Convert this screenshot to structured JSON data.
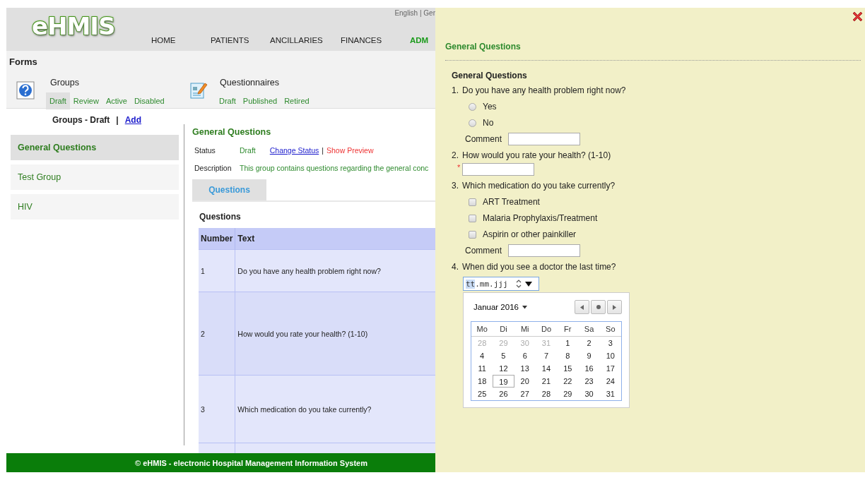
{
  "header": {
    "logo": "eHMIS",
    "languages": "English | Ger",
    "nav": [
      {
        "label": "HOME",
        "selected": false
      },
      {
        "label": "PATIENTS",
        "selected": false
      },
      {
        "label": "ANCILLARIES",
        "selected": false
      },
      {
        "label": "FINANCES",
        "selected": false
      },
      {
        "label": "ADM",
        "selected": true
      }
    ]
  },
  "forms_bar": {
    "title": "Forms",
    "sections": [
      {
        "label": "Groups",
        "kind": "help",
        "tabs": [
          {
            "label": "Draft",
            "selected": true
          },
          {
            "label": "Review",
            "selected": false
          },
          {
            "label": "Active",
            "selected": false
          },
          {
            "label": "Disabled",
            "selected": false
          }
        ]
      },
      {
        "label": "Questionnaires",
        "kind": "questionnaire",
        "tabs": [
          {
            "label": "Draft",
            "selected": false
          },
          {
            "label": "Published",
            "selected": false
          },
          {
            "label": "Retired",
            "selected": false
          }
        ]
      }
    ]
  },
  "sidebar": {
    "heading": "Groups - Draft",
    "separator": "|",
    "add_link": "Add",
    "items": [
      {
        "label": "General Questions",
        "selected": true
      },
      {
        "label": "Test Group",
        "selected": false
      },
      {
        "label": "HIV",
        "selected": false
      }
    ]
  },
  "detail": {
    "title": "General Questions",
    "status": {
      "label": "Status",
      "value": "Draft",
      "change_link": "Change Status",
      "separator": "|",
      "preview_link": "Show Preview"
    },
    "description": {
      "label": "Description",
      "value": "This group contains questions regarding the general conc"
    },
    "tabs": [
      {
        "label": "Questions",
        "selected": true
      }
    ],
    "section_title": "Questions",
    "table": {
      "columns": [
        "Number",
        "Text"
      ],
      "rows": [
        {
          "number": "1",
          "text": "Do you have any health problem right now?"
        },
        {
          "number": "2",
          "text": "How would you rate your health? (1-10)"
        },
        {
          "number": "3",
          "text": "Which medication do you take currently?"
        }
      ]
    }
  },
  "footer": "© eHMIS - electronic Hospital Management Information System",
  "preview": {
    "title": "General Questions",
    "group_title": "General Questions",
    "questions": [
      {
        "number": "1.",
        "text": "Do you have any health problem right now?",
        "kind": "radio",
        "options": [
          {
            "label": "Yes",
            "checked": false
          },
          {
            "label": "No",
            "checked": false
          }
        ],
        "comment_label": "Comment"
      },
      {
        "number": "2.",
        "text": "How would you rate your health? (1-10)",
        "kind": "number",
        "required_mark": "*"
      },
      {
        "number": "3.",
        "text": "Which medication do you take currently?",
        "kind": "checkbox",
        "options": [
          {
            "label": "ART Treatment",
            "checked": false
          },
          {
            "label": "Malaria Prophylaxis/Treatment",
            "checked": false
          },
          {
            "label": "Aspirin or other painkiller",
            "checked": false
          }
        ],
        "comment_label": "Comment"
      },
      {
        "number": "4.",
        "text": "When did you see a doctor the last time?",
        "kind": "date",
        "placeholder": "tt.mm.jjj",
        "calendar": {
          "month": "Januar 2016",
          "weekdays": [
            "Mo",
            "Di",
            "Mi",
            "Do",
            "Fr",
            "Sa",
            "So"
          ],
          "weeks": [
            [
              {
                "day": "28",
                "other_month": true,
                "selected": false
              },
              {
                "day": "29",
                "other_month": true,
                "selected": false
              },
              {
                "day": "30",
                "other_month": true,
                "selected": false
              },
              {
                "day": "31",
                "other_month": true,
                "selected": false
              },
              {
                "day": "1",
                "other_month": false,
                "selected": false
              },
              {
                "day": "2",
                "other_month": false,
                "selected": false
              },
              {
                "day": "3",
                "other_month": false,
                "selected": false
              }
            ],
            [
              {
                "day": "4",
                "other_month": false,
                "selected": false
              },
              {
                "day": "5",
                "other_month": false,
                "selected": false
              },
              {
                "day": "6",
                "other_month": false,
                "selected": false
              },
              {
                "day": "7",
                "other_month": false,
                "selected": false
              },
              {
                "day": "8",
                "other_month": false,
                "selected": false
              },
              {
                "day": "9",
                "other_month": false,
                "selected": false
              },
              {
                "day": "10",
                "other_month": false,
                "selected": false
              }
            ],
            [
              {
                "day": "11",
                "other_month": false,
                "selected": false
              },
              {
                "day": "12",
                "other_month": false,
                "selected": false
              },
              {
                "day": "13",
                "other_month": false,
                "selected": false
              },
              {
                "day": "14",
                "other_month": false,
                "selected": false
              },
              {
                "day": "15",
                "other_month": false,
                "selected": false
              },
              {
                "day": "16",
                "other_month": false,
                "selected": false
              },
              {
                "day": "17",
                "other_month": false,
                "selected": false
              }
            ],
            [
              {
                "day": "18",
                "other_month": false,
                "selected": false
              },
              {
                "day": "19",
                "other_month": false,
                "selected": true
              },
              {
                "day": "20",
                "other_month": false,
                "selected": false
              },
              {
                "day": "21",
                "other_month": false,
                "selected": false
              },
              {
                "day": "22",
                "other_month": false,
                "selected": false
              },
              {
                "day": "23",
                "other_month": false,
                "selected": false
              },
              {
                "day": "24",
                "other_month": false,
                "selected": false
              }
            ],
            [
              {
                "day": "25",
                "other_month": false,
                "selected": false
              },
              {
                "day": "26",
                "other_month": false,
                "selected": false
              },
              {
                "day": "27",
                "other_month": false,
                "selected": false
              },
              {
                "day": "28",
                "other_month": false,
                "selected": false
              },
              {
                "day": "29",
                "other_month": false,
                "selected": false
              },
              {
                "day": "30",
                "other_month": false,
                "selected": false
              },
              {
                "day": "31",
                "other_month": false,
                "selected": false
              }
            ]
          ]
        }
      }
    ]
  }
}
